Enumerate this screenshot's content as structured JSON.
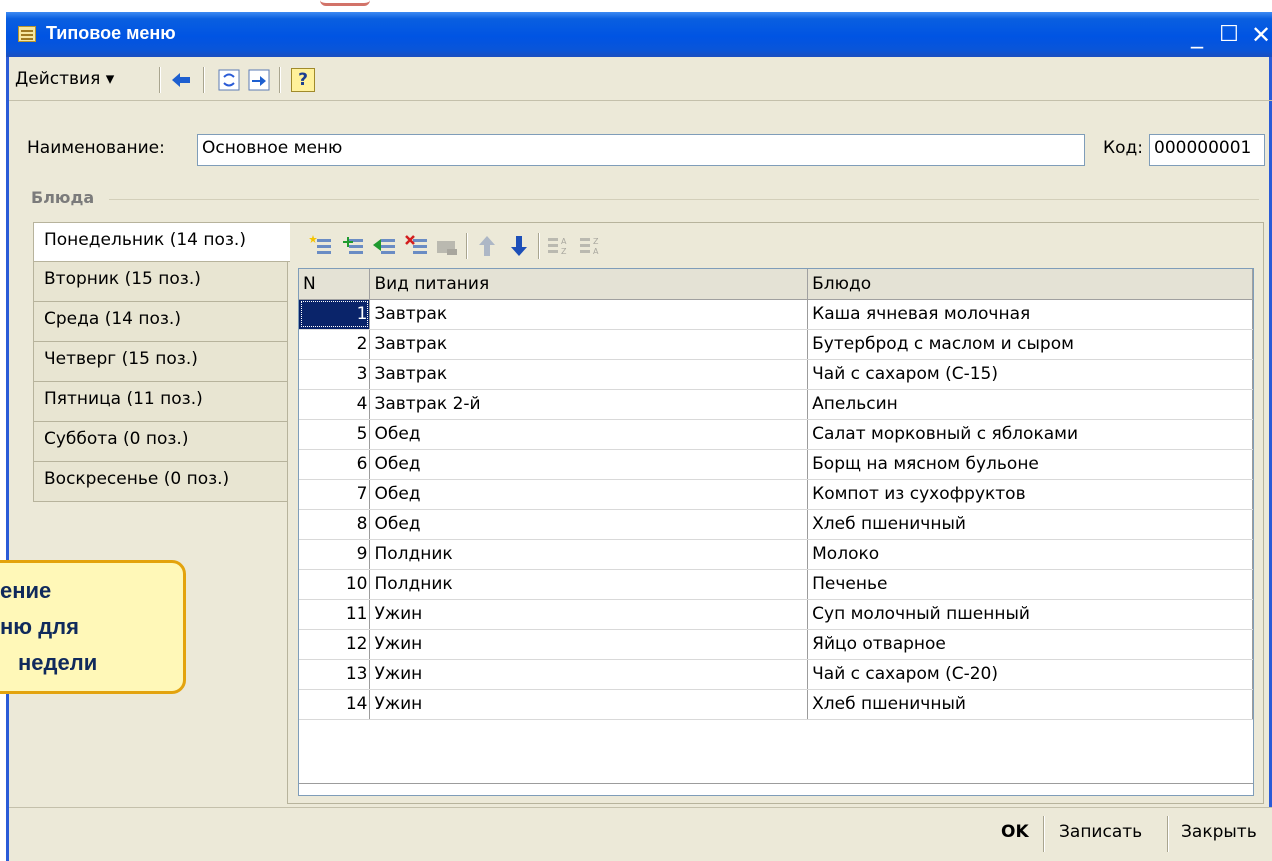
{
  "window": {
    "title": "Типовое меню",
    "minimize_glyph": "_",
    "maximize_glyph": "☐",
    "close_glyph": "✕"
  },
  "toolbar": {
    "actions_label": "Действия ▾",
    "help_glyph": "?"
  },
  "form": {
    "name_label": "Наименование:",
    "name_value": "Основное меню",
    "code_label": "Код:",
    "code_value": "000000001",
    "section_title": "Блюда"
  },
  "tabs": [
    {
      "label": "Понедельник (14 поз.)",
      "active": true
    },
    {
      "label": "Вторник (15 поз.)",
      "active": false
    },
    {
      "label": "Среда (14 поз.)",
      "active": false
    },
    {
      "label": "Четверг (15 поз.)",
      "active": false
    },
    {
      "label": "Пятница (11 поз.)",
      "active": false
    },
    {
      "label": "Суббота (0 поз.)",
      "active": false
    },
    {
      "label": "Воскресенье (0 поз.)",
      "active": false
    }
  ],
  "grid": {
    "columns": [
      "N",
      "Вид питания",
      "Блюдо"
    ],
    "rows": [
      {
        "n": "1",
        "type": "Завтрак",
        "dish": "Каша ячневая молочная"
      },
      {
        "n": "2",
        "type": "Завтрак",
        "dish": "Бутерброд с маслом и сыром"
      },
      {
        "n": "3",
        "type": "Завтрак",
        "dish": "Чай с сахаром (С-15)"
      },
      {
        "n": "4",
        "type": "Завтрак 2-й",
        "dish": "Апельсин"
      },
      {
        "n": "5",
        "type": "Обед",
        "dish": "Салат морковный с яблоками"
      },
      {
        "n": "6",
        "type": "Обед",
        "dish": "Борщ на мясном бульоне"
      },
      {
        "n": "7",
        "type": "Обед",
        "dish": "Компот из сухофруктов"
      },
      {
        "n": "8",
        "type": "Обед",
        "dish": "Хлеб пшеничный"
      },
      {
        "n": "9",
        "type": "Полдник",
        "dish": "Молоко"
      },
      {
        "n": "10",
        "type": "Полдник",
        "dish": "Печенье"
      },
      {
        "n": "11",
        "type": "Ужин",
        "dish": "Суп молочный пшенный"
      },
      {
        "n": "12",
        "type": "Ужин",
        "dish": "Яйцо отварное"
      },
      {
        "n": "13",
        "type": "Ужин",
        "dish": "Чай с сахаром (С-20)"
      },
      {
        "n": "14",
        "type": "Ужин",
        "dish": "Хлеб пшеничный"
      }
    ],
    "selected_row": 1
  },
  "buttons": {
    "ok": "OK",
    "save": "Записать",
    "close": "Закрыть"
  },
  "callout": {
    "lines": [
      "ение",
      "ню для",
      "недели"
    ]
  },
  "colors": {
    "titlebar": "#0054e3",
    "window_bg": "#ece9d8",
    "selection": "#0a246a",
    "callout_fill": "#fff8b8",
    "callout_border": "#e3a30d"
  }
}
